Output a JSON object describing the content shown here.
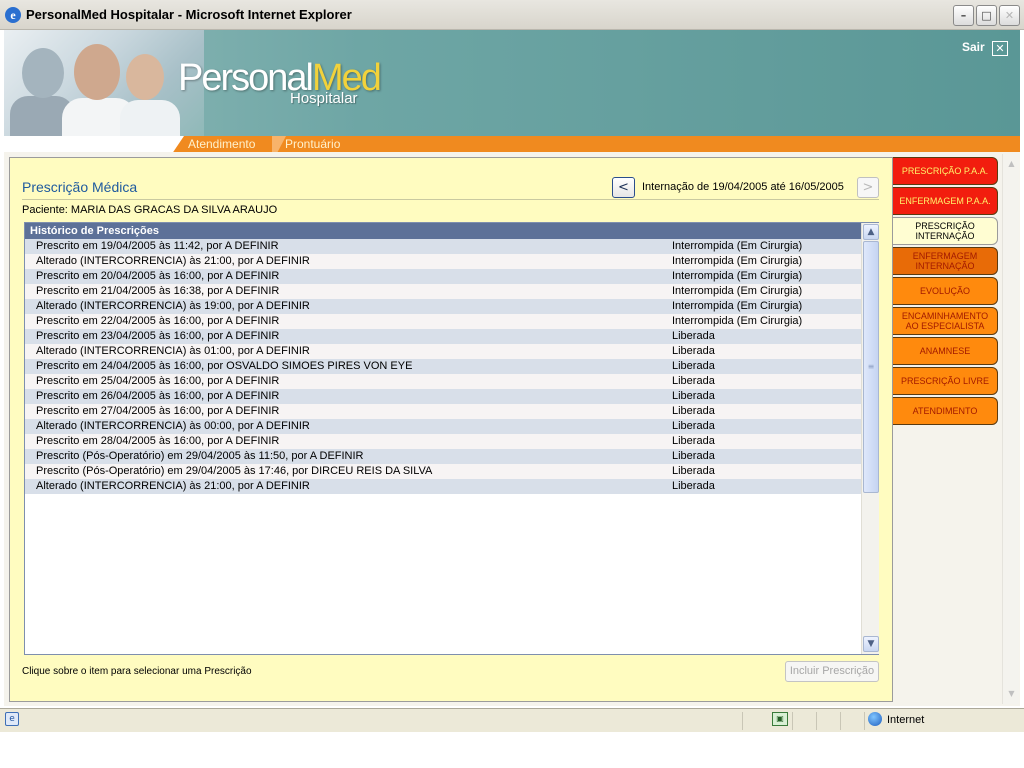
{
  "window": {
    "title": "PersonalMed Hospitalar - Microsoft Internet Explorer",
    "app_icon": "e",
    "min_glyph": "–",
    "max_glyph": "□",
    "close_glyph": "✕"
  },
  "header": {
    "logo_personal": "Personal",
    "logo_med": "Med",
    "logo_sub": "Hospitalar",
    "exit_label": "Sair",
    "exit_glyph": "✕"
  },
  "nav": {
    "items": [
      "Atendimento",
      "Prontuário"
    ]
  },
  "page": {
    "title": "Prescrição Médica",
    "patient": "Paciente: MARIA DAS GRACAS DA SILVA ARAUJO",
    "prev_glyph": "<",
    "next_glyph": ">",
    "internacao": "Internação de 19/04/2005 até 16/05/2005",
    "hint": "Clique sobre o item para selecionar uma Prescrição",
    "incluir_button": "Incluir Prescrição"
  },
  "table": {
    "header": "Histórico de Prescrições",
    "scroll_up": "▲",
    "scroll_down": "▼",
    "thumb_grip": "≡",
    "rows": [
      {
        "desc": "Prescrito em 19/04/2005 às 11:42, por A DEFINIR",
        "status": "Interrompida (Em Cirurgia)"
      },
      {
        "desc": "Alterado (INTERCORRENCIA) às 21:00, por A DEFINIR",
        "status": "Interrompida (Em Cirurgia)"
      },
      {
        "desc": "Prescrito em 20/04/2005 às 16:00, por A DEFINIR",
        "status": "Interrompida (Em Cirurgia)"
      },
      {
        "desc": "Prescrito em 21/04/2005 às 16:38, por A DEFINIR",
        "status": "Interrompida (Em Cirurgia)"
      },
      {
        "desc": "Alterado (INTERCORRENCIA) às 19:00, por A DEFINIR",
        "status": "Interrompida (Em Cirurgia)"
      },
      {
        "desc": "Prescrito em 22/04/2005 às 16:00, por A DEFINIR",
        "status": "Interrompida (Em Cirurgia)"
      },
      {
        "desc": "Prescrito em 23/04/2005 às 16:00, por A DEFINIR",
        "status": "Liberada"
      },
      {
        "desc": "Alterado (INTERCORRENCIA) às 01:00, por A DEFINIR",
        "status": "Liberada"
      },
      {
        "desc": "Prescrito em 24/04/2005 às 16:00, por OSVALDO SIMOES PIRES VON EYE",
        "status": "Liberada"
      },
      {
        "desc": "Prescrito em 25/04/2005 às 16:00, por A DEFINIR",
        "status": "Liberada"
      },
      {
        "desc": "Prescrito em 26/04/2005 às 16:00, por A DEFINIR",
        "status": "Liberada"
      },
      {
        "desc": "Prescrito em 27/04/2005 às 16:00, por A DEFINIR",
        "status": "Liberada"
      },
      {
        "desc": "Alterado (INTERCORRENCIA) às 00:00, por A DEFINIR",
        "status": "Liberada"
      },
      {
        "desc": "Prescrito em 28/04/2005 às 16:00, por A DEFINIR",
        "status": "Liberada"
      },
      {
        "desc": "Prescrito (Pós-Operatório) em 29/04/2005 às 11:50, por A DEFINIR",
        "status": "Liberada"
      },
      {
        "desc": "Prescrito (Pós-Operatório) em 29/04/2005 às 17:46, por DIRCEU REIS DA SILVA",
        "status": "Liberada"
      },
      {
        "desc": "Alterado (INTERCORRENCIA) às 21:00, por A DEFINIR",
        "status": "Liberada"
      }
    ]
  },
  "tabs": [
    {
      "label": "PRESCRIÇÃO P.A.A.",
      "style": "red"
    },
    {
      "label": "ENFERMAGEM P.A.A.",
      "style": "red"
    },
    {
      "label": "PRESCRIÇÃO INTERNAÇÃO",
      "style": "active"
    },
    {
      "label": "ENFERMAGEM INTERNAÇÃO",
      "style": "orange-dark"
    },
    {
      "label": "EVOLUÇÃO",
      "style": "orange"
    },
    {
      "label": "ENCAMINHAMENTO AO ESPECIALISTA",
      "style": "orange"
    },
    {
      "label": "ANAMNESE",
      "style": "orange"
    },
    {
      "label": "PRESCRIÇÃO LIVRE",
      "style": "orange"
    },
    {
      "label": "ATENDIMENTO",
      "style": "orange"
    }
  ],
  "page_scroll": {
    "up": "▲",
    "down": "▼"
  },
  "status_bar": {
    "page_icon": "e",
    "security_icon": "▣",
    "zone": "Internet"
  },
  "colors": {
    "accent_orange": "#f08a1f",
    "tab_red": "#f21d0e",
    "panel_yellow": "#fffcc0",
    "table_header": "#5d7198",
    "title_blue": "#1f5a9e"
  }
}
